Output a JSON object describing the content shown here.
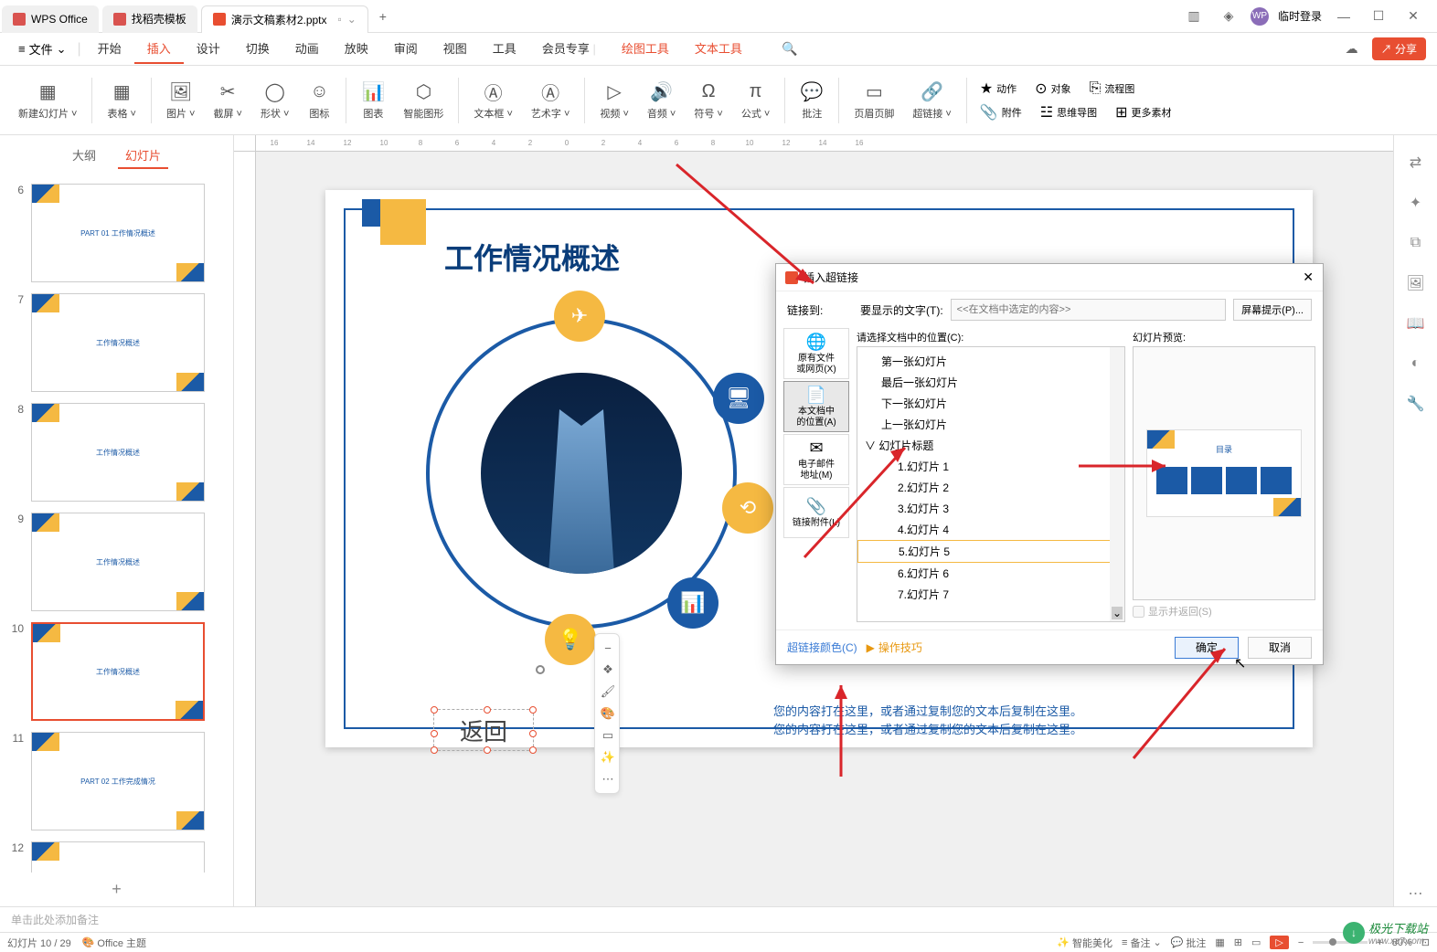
{
  "titlebar": {
    "tabs": [
      {
        "label": "WPS Office",
        "icon": "wps"
      },
      {
        "label": "找稻壳模板",
        "icon": "tpl"
      },
      {
        "label": "演示文稿素材2.pptx",
        "icon": "ppt"
      }
    ],
    "login": "临时登录"
  },
  "menubar": {
    "file": "文件",
    "items": [
      "开始",
      "插入",
      "设计",
      "切换",
      "动画",
      "放映",
      "审阅",
      "视图",
      "工具",
      "会员专享",
      "绘图工具",
      "文本工具"
    ],
    "active": "插入",
    "highlight": [
      "绘图工具",
      "文本工具"
    ],
    "share": "分享"
  },
  "ribbon": {
    "items": [
      "新建幻灯片",
      "表格",
      "图片",
      "截屏",
      "形状",
      "图标",
      "图表",
      "智能图形",
      "文本框",
      "艺术字",
      "视频",
      "音频",
      "符号",
      "公式",
      "批注",
      "页眉页脚",
      "超链接"
    ],
    "group2": [
      {
        "icon": "★",
        "label": "动作"
      },
      {
        "icon": "⊙",
        "label": "对象"
      },
      {
        "icon": "⎘",
        "label": "流程图"
      },
      {
        "icon": "📎",
        "label": "附件"
      },
      {
        "icon": "☳",
        "label": "思维导图"
      },
      {
        "icon": "⊞",
        "label": "更多素材"
      }
    ]
  },
  "slidepanel": {
    "tabs": [
      "大纲",
      "幻灯片"
    ],
    "active_tab": "幻灯片",
    "thumbs": [
      {
        "num": "6",
        "title": "PART 01 工作情况概述"
      },
      {
        "num": "7",
        "title": "工作情况概述"
      },
      {
        "num": "8",
        "title": "工作情况概述"
      },
      {
        "num": "9",
        "title": "工作情况概述"
      },
      {
        "num": "10",
        "title": "工作情况概述"
      },
      {
        "num": "11",
        "title": "PART 02 工作完成情况"
      },
      {
        "num": "12",
        "title": ""
      }
    ],
    "active_thumb": "10"
  },
  "slide": {
    "title": "工作情况概述",
    "return_label": "返回",
    "content_line1": "您的内容打在这里，或者通过复制您的文本后复制在这里。",
    "content_line2": "您的内容打在这里，或者通过复制您的文本后复制在这里。"
  },
  "dialog": {
    "title": "插入超链接",
    "linkto_label": "链接到:",
    "display_label": "要显示的文字(T):",
    "display_placeholder": "<<在文档中选定的内容>>",
    "screentip": "屏幕提示(P)...",
    "linkto_items": [
      {
        "icon": "🌐",
        "label": "原有文件\n或网页(X)"
      },
      {
        "icon": "📄",
        "label": "本文档中\n的位置(A)"
      },
      {
        "icon": "✉",
        "label": "电子邮件\n地址(M)"
      },
      {
        "icon": "📎",
        "label": "链接附件(L)"
      }
    ],
    "linkto_active": 1,
    "doc_label": "请选择文档中的位置(C):",
    "tree": [
      {
        "label": "第一张幻灯片",
        "indent": 1
      },
      {
        "label": "最后一张幻灯片",
        "indent": 1
      },
      {
        "label": "下一张幻灯片",
        "indent": 1
      },
      {
        "label": "上一张幻灯片",
        "indent": 1
      },
      {
        "label": "∨ 幻灯片标题",
        "indent": 0
      },
      {
        "label": "1.幻灯片 1",
        "indent": 2
      },
      {
        "label": "2.幻灯片 2",
        "indent": 2
      },
      {
        "label": "3.幻灯片 3",
        "indent": 2
      },
      {
        "label": "4.幻灯片 4",
        "indent": 2
      },
      {
        "label": "5.幻灯片 5",
        "indent": 2,
        "selected": true
      },
      {
        "label": "6.幻灯片 6",
        "indent": 2
      },
      {
        "label": "7.幻灯片 7",
        "indent": 2
      }
    ],
    "preview_label": "幻灯片预览:",
    "preview_title": "目录",
    "show_return": "显示并返回(S)",
    "link_color": "超链接颜色(C)",
    "tips": "操作技巧",
    "ok": "确定",
    "cancel": "取消"
  },
  "notes": "单击此处添加备注",
  "statusbar": {
    "slide_info": "幻灯片 10 / 29",
    "theme": "Office 主题",
    "smart": "智能美化",
    "notes_btn": "备注",
    "comments": "批注",
    "zoom": "80%"
  },
  "watermark": {
    "text": "极光下载站",
    "url": "www.xz7.com"
  },
  "ruler_marks": [
    "16",
    "14",
    "12",
    "10",
    "8",
    "6",
    "4",
    "2",
    "0",
    "2",
    "4",
    "6",
    "8",
    "10",
    "12",
    "14",
    "16"
  ]
}
